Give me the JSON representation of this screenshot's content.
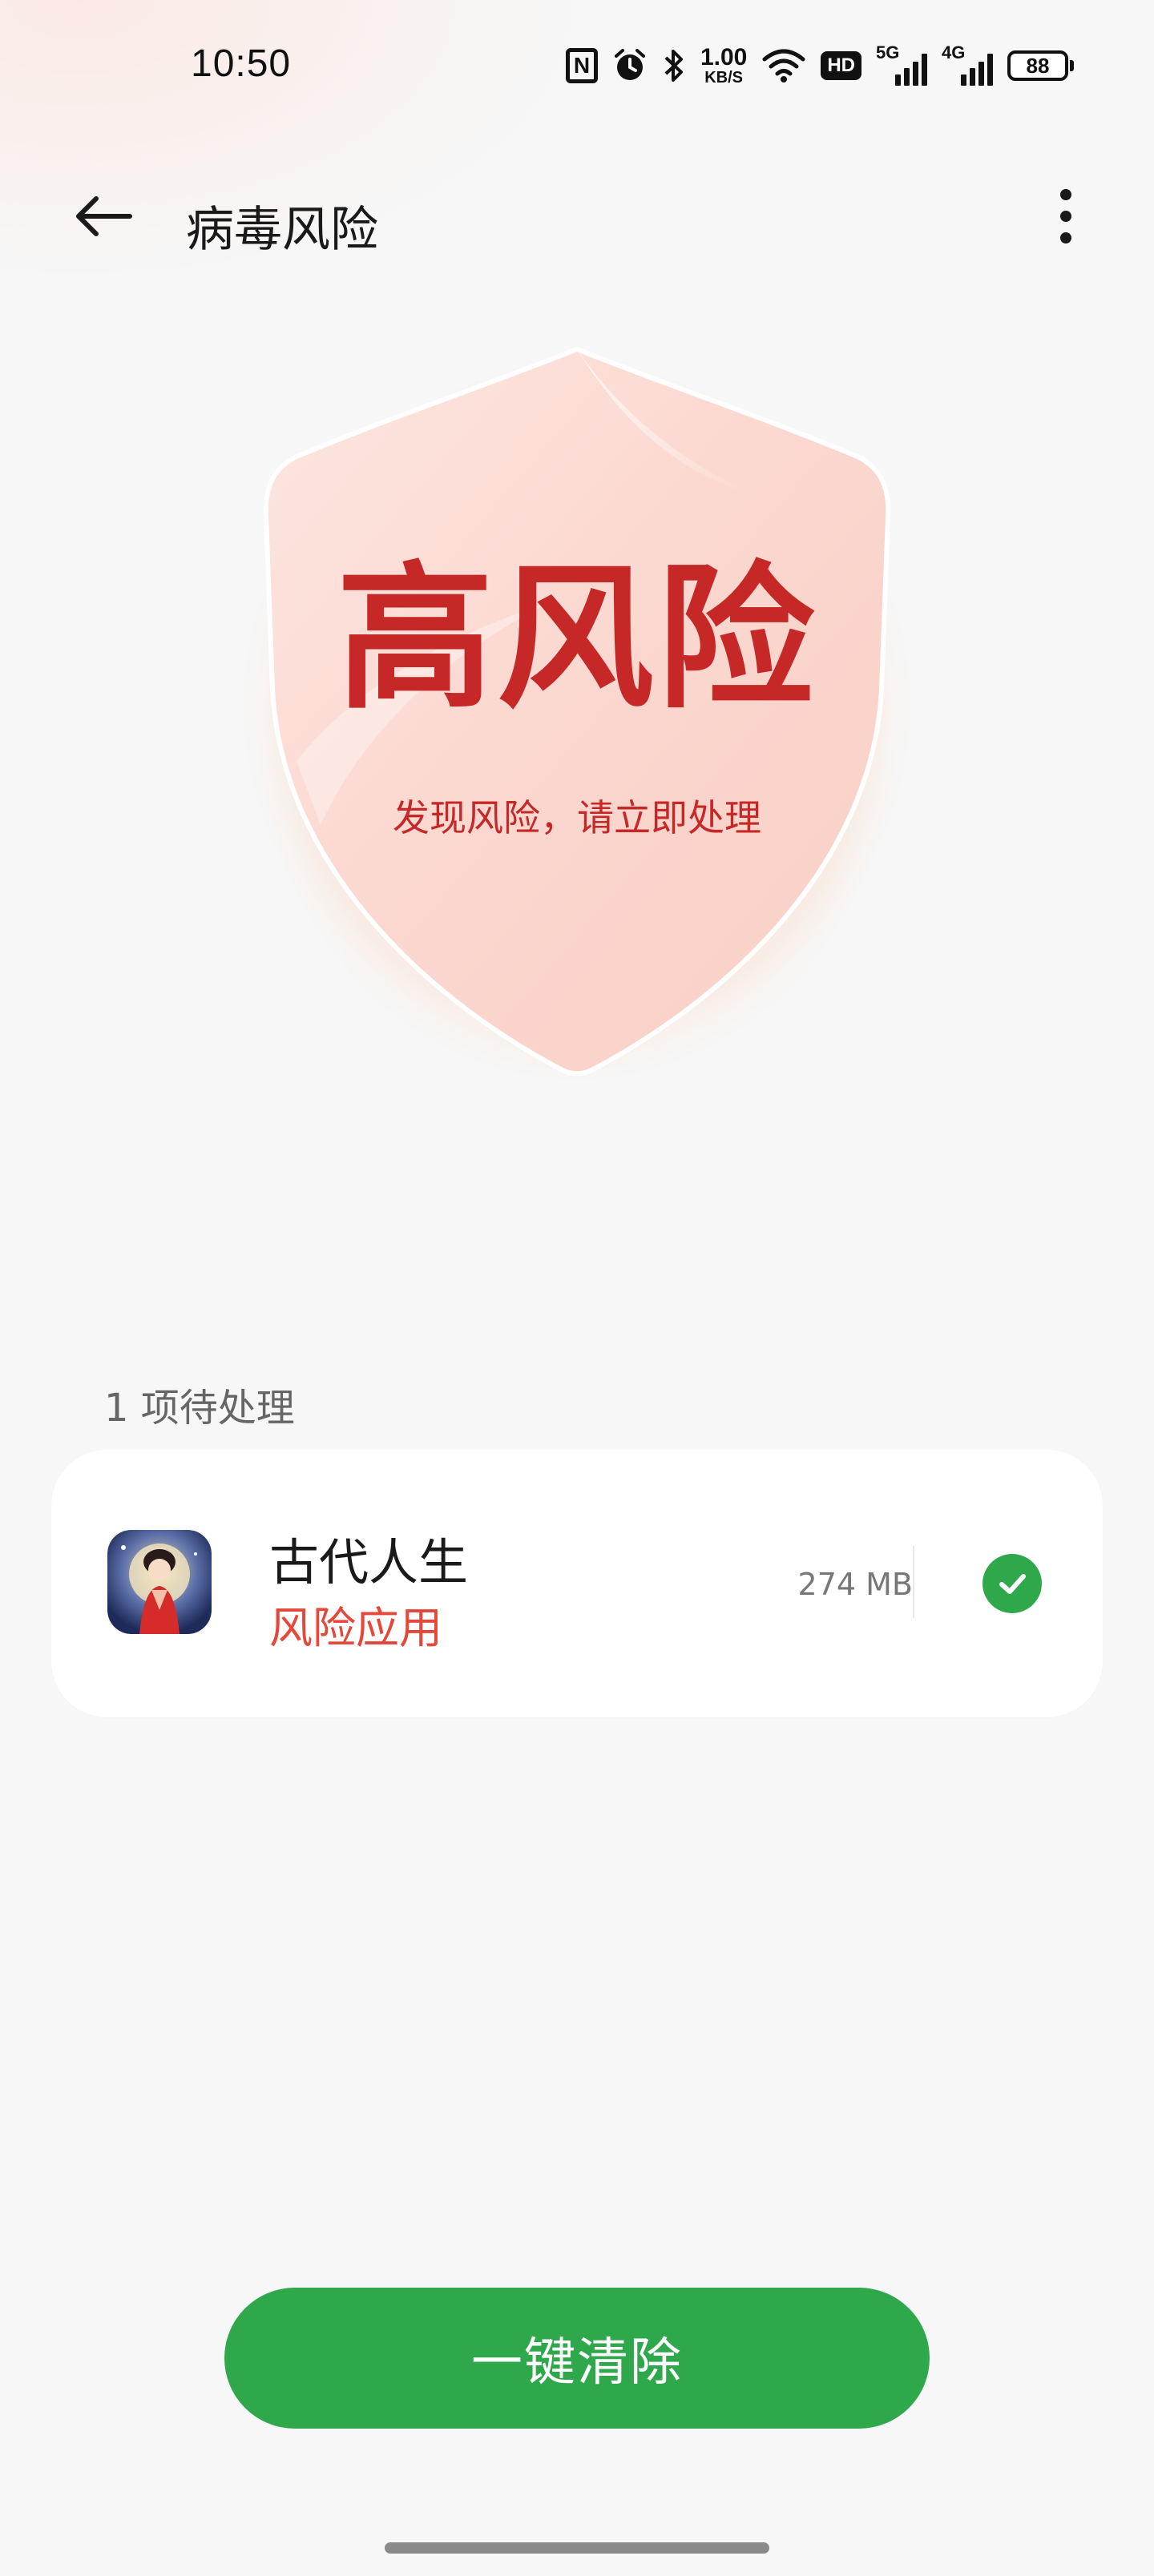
{
  "status_bar": {
    "time": "10:50",
    "nfc_label": "N",
    "net_speed_value": "1.00",
    "net_speed_unit": "KB/S",
    "hd_label": "HD",
    "network_1": "5G",
    "network_2": "4G",
    "battery": "88"
  },
  "app_bar": {
    "title": "病毒风险",
    "back_icon": "arrow-left-icon",
    "more_icon": "more-vertical-icon"
  },
  "status_card": {
    "risk_level": "高风险",
    "message": "发现风险，请立即处理"
  },
  "section": {
    "header": "1 项待处理"
  },
  "items": [
    {
      "name": "古代人生",
      "tag": "风险应用",
      "size": "274 MB",
      "selected": true
    }
  ],
  "actions": {
    "clean_label": "一键清除"
  },
  "colors": {
    "accent_green": "#2ea84a",
    "risk_red": "#c62828",
    "tag_red": "#e5473a",
    "glow_orange": "#ff8c46"
  }
}
